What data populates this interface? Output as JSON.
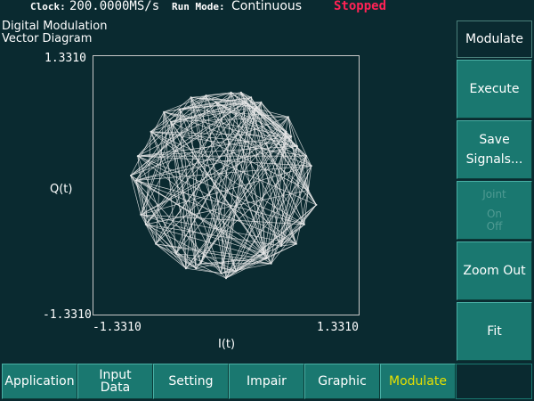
{
  "status": {
    "clock_label": "Clock:",
    "clock_value": "200.0000MS/s",
    "run_mode_label": "Run Mode:",
    "run_mode_value": "Continuous",
    "state": "Stopped"
  },
  "graph": {
    "title_line1": "Digital Modulation",
    "title_line2": "Vector Diagram",
    "y_axis_label": "Q(t)",
    "x_axis_label": "I(t)",
    "y_max_label": "1.3310",
    "y_min_label": "-1.3310",
    "x_min_label": "-1.3310",
    "x_max_label": "1.3310"
  },
  "side_menu": {
    "header": "Modulate",
    "execute": "Execute",
    "save_line1": "Save",
    "save_line2": "Signals...",
    "joint_label": "Joint",
    "joint_on": "On",
    "joint_off": "Off",
    "zoom_out": "Zoom Out",
    "fit": "Fit"
  },
  "tabs": {
    "application": "Application",
    "input_data_line1": "Input",
    "input_data_line2": "Data",
    "setting": "Setting",
    "impair": "Impair",
    "graphic": "Graphic",
    "modulate": "Modulate"
  },
  "colors": {
    "background": "#0a2a30",
    "button": "#1a7870",
    "trace": "#e8e8e8",
    "stopped": "#ff2255",
    "active_tab": "#e6e000"
  },
  "chart_data": {
    "type": "scatter",
    "title": "Digital Modulation Vector Diagram",
    "xlabel": "I(t)",
    "ylabel": "Q(t)",
    "xlim": [
      -1.331,
      1.331
    ],
    "ylim": [
      -1.331,
      1.331
    ],
    "x": [
      0.05,
      0.6,
      0.82,
      0.38,
      -0.3,
      -0.8,
      -0.88,
      -0.46,
      0.2,
      0.71,
      -0.62,
      -0.05,
      0.55,
      0.85,
      0.35,
      -0.35,
      -0.9,
      -0.5,
      0.1,
      0.78,
      0.62,
      -0.25,
      -0.75,
      -0.2,
      0.45,
      0.9,
      0.0,
      -0.7,
      0.3,
      0.7,
      -0.85,
      -0.55,
      0.15,
      0.65,
      -0.4,
      0.8,
      -0.1,
      -0.95,
      0.4,
      0.25
    ],
    "y": [
      0.95,
      0.55,
      -0.05,
      -0.7,
      -0.85,
      -0.4,
      0.3,
      0.78,
      0.85,
      0.4,
      0.75,
      -0.9,
      -0.62,
      0.2,
      0.85,
      0.9,
      0.05,
      -0.7,
      -0.88,
      -0.4,
      0.7,
      -0.8,
      0.55,
      0.92,
      -0.8,
      -0.2,
      -0.95,
      -0.6,
      0.8,
      -0.6,
      -0.3,
      0.65,
      0.95,
      0.5,
      -0.85,
      0.3,
      0.85,
      0.1,
      -0.75,
      0.9
    ]
  }
}
